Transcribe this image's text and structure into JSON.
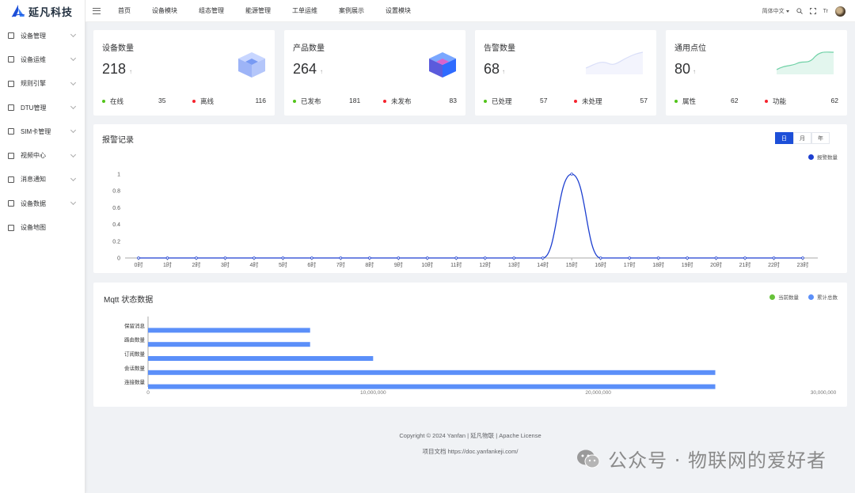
{
  "brand": {
    "logo_text": "延凡科技"
  },
  "sidebar": {
    "items": [
      {
        "label": "设备管理",
        "icon": "device-icon"
      },
      {
        "label": "设备运维",
        "icon": "wrench-icon"
      },
      {
        "label": "规则引擎",
        "icon": "rule-icon"
      },
      {
        "label": "DTU管理",
        "icon": "dtu-icon"
      },
      {
        "label": "SIM卡管理",
        "icon": "sim-icon"
      },
      {
        "label": "视频中心",
        "icon": "video-icon"
      },
      {
        "label": "消息通知",
        "icon": "message-icon"
      },
      {
        "label": "设备数据",
        "icon": "monitor-icon"
      },
      {
        "label": "设备地图",
        "icon": "map-icon"
      }
    ]
  },
  "topbar": {
    "nav": [
      "首页",
      "设备模块",
      "组态管理",
      "能源管理",
      "工单运维",
      "案例展示",
      "设置模块"
    ],
    "language": "简体中文",
    "font_icon_text": "Tr"
  },
  "cards": [
    {
      "title": "设备数量",
      "value": "218",
      "up": "↑",
      "left_label": "在线",
      "left_value": "35",
      "right_label": "离线",
      "right_value": "116",
      "left_color": "#52c41a",
      "right_color": "#f5222d",
      "graphic": "cube-icon-blue"
    },
    {
      "title": "产品数量",
      "value": "264",
      "up": "↑",
      "left_label": "已发布",
      "left_value": "181",
      "right_label": "未发布",
      "right_value": "83",
      "left_color": "#52c41a",
      "right_color": "#f5222d",
      "graphic": "cube-icon-multicolor"
    },
    {
      "title": "告警数量",
      "value": "68",
      "up": "↑",
      "left_label": "已处理",
      "left_value": "57",
      "right_label": "未处理",
      "right_value": "57",
      "left_color": "#52c41a",
      "right_color": "#f5222d",
      "graphic": "sparkline-purple"
    },
    {
      "title": "通用点位",
      "value": "80",
      "up": "↑",
      "left_label": "属性",
      "left_value": "62",
      "right_label": "功能",
      "right_value": "62",
      "left_color": "#52c41a",
      "right_color": "#f5222d",
      "graphic": "sparkline-green"
    }
  ],
  "alarm_panel": {
    "title": "报警记录",
    "tabs": [
      "日",
      "月",
      "年"
    ],
    "active_tab": "日",
    "legend": "报警数量",
    "color": "#2f54eb"
  },
  "mqtt_panel": {
    "title": "Mqtt 状态数据",
    "legend": [
      {
        "label": "当前数量",
        "color": "#67c23a"
      },
      {
        "label": "累计总数",
        "color": "#5b8ff9"
      }
    ]
  },
  "chart_data": [
    {
      "type": "line",
      "title": "报警记录",
      "x": [
        "0时",
        "1时",
        "2时",
        "3时",
        "4时",
        "5时",
        "6时",
        "7时",
        "8时",
        "9时",
        "10时",
        "11时",
        "12时",
        "13时",
        "14时",
        "15时",
        "16时",
        "17时",
        "18时",
        "19时",
        "20时",
        "21时",
        "22时",
        "23时"
      ],
      "series": [
        {
          "name": "报警数量",
          "values": [
            0,
            0,
            0,
            0,
            0,
            0,
            0,
            0,
            0,
            0,
            0,
            0,
            0,
            0,
            0,
            1,
            0,
            0,
            0,
            0,
            0,
            0,
            0,
            0
          ]
        }
      ],
      "yticks": [
        "0",
        "0.2",
        "0.4",
        "0.6",
        "0.8",
        "1"
      ],
      "ylim": [
        0,
        1
      ],
      "grid": false,
      "legend": "top-right"
    },
    {
      "type": "bar",
      "orientation": "horizontal",
      "title": "Mqtt 状态数据",
      "categories": [
        "保留消息",
        "路由数量",
        "订阅数量",
        "会话数量",
        "连接数量"
      ],
      "series": [
        {
          "name": "累计总数",
          "values": [
            7200000,
            7200000,
            10000000,
            25200000,
            25200000
          ]
        },
        {
          "name": "当前数量",
          "values": [
            0,
            0,
            0,
            0,
            0
          ]
        }
      ],
      "xticks": [
        "0",
        "10,000,000",
        "20,000,000",
        "30,000,000"
      ],
      "xlim": [
        0,
        30000000
      ],
      "legend": "top-right"
    }
  ],
  "footer": {
    "copyright": "Copyright © 2024 Yanfan | 延凡物联 | Apache License",
    "doc": "项目文档 https://doc.yanfankeji.com/"
  },
  "watermark": "公众号 · 物联网的爱好者"
}
